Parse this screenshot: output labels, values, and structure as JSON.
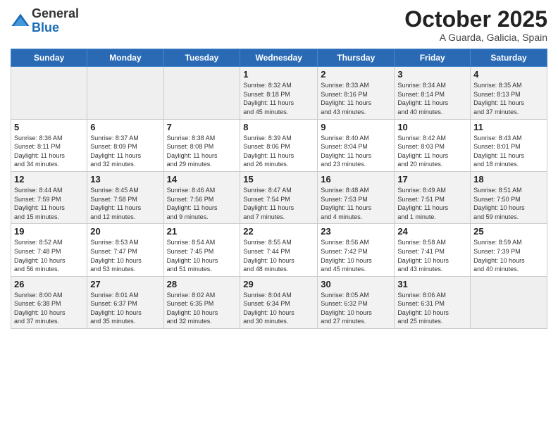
{
  "logo": {
    "general": "General",
    "blue": "Blue"
  },
  "title": {
    "month": "October 2025",
    "location": "A Guarda, Galicia, Spain"
  },
  "weekdays": [
    "Sunday",
    "Monday",
    "Tuesday",
    "Wednesday",
    "Thursday",
    "Friday",
    "Saturday"
  ],
  "rows": [
    [
      {
        "day": "",
        "text": ""
      },
      {
        "day": "",
        "text": ""
      },
      {
        "day": "",
        "text": ""
      },
      {
        "day": "1",
        "text": "Sunrise: 8:32 AM\nSunset: 8:18 PM\nDaylight: 11 hours\nand 45 minutes."
      },
      {
        "day": "2",
        "text": "Sunrise: 8:33 AM\nSunset: 8:16 PM\nDaylight: 11 hours\nand 43 minutes."
      },
      {
        "day": "3",
        "text": "Sunrise: 8:34 AM\nSunset: 8:14 PM\nDaylight: 11 hours\nand 40 minutes."
      },
      {
        "day": "4",
        "text": "Sunrise: 8:35 AM\nSunset: 8:13 PM\nDaylight: 11 hours\nand 37 minutes."
      }
    ],
    [
      {
        "day": "5",
        "text": "Sunrise: 8:36 AM\nSunset: 8:11 PM\nDaylight: 11 hours\nand 34 minutes."
      },
      {
        "day": "6",
        "text": "Sunrise: 8:37 AM\nSunset: 8:09 PM\nDaylight: 11 hours\nand 32 minutes."
      },
      {
        "day": "7",
        "text": "Sunrise: 8:38 AM\nSunset: 8:08 PM\nDaylight: 11 hours\nand 29 minutes."
      },
      {
        "day": "8",
        "text": "Sunrise: 8:39 AM\nSunset: 8:06 PM\nDaylight: 11 hours\nand 26 minutes."
      },
      {
        "day": "9",
        "text": "Sunrise: 8:40 AM\nSunset: 8:04 PM\nDaylight: 11 hours\nand 23 minutes."
      },
      {
        "day": "10",
        "text": "Sunrise: 8:42 AM\nSunset: 8:03 PM\nDaylight: 11 hours\nand 20 minutes."
      },
      {
        "day": "11",
        "text": "Sunrise: 8:43 AM\nSunset: 8:01 PM\nDaylight: 11 hours\nand 18 minutes."
      }
    ],
    [
      {
        "day": "12",
        "text": "Sunrise: 8:44 AM\nSunset: 7:59 PM\nDaylight: 11 hours\nand 15 minutes."
      },
      {
        "day": "13",
        "text": "Sunrise: 8:45 AM\nSunset: 7:58 PM\nDaylight: 11 hours\nand 12 minutes."
      },
      {
        "day": "14",
        "text": "Sunrise: 8:46 AM\nSunset: 7:56 PM\nDaylight: 11 hours\nand 9 minutes."
      },
      {
        "day": "15",
        "text": "Sunrise: 8:47 AM\nSunset: 7:54 PM\nDaylight: 11 hours\nand 7 minutes."
      },
      {
        "day": "16",
        "text": "Sunrise: 8:48 AM\nSunset: 7:53 PM\nDaylight: 11 hours\nand 4 minutes."
      },
      {
        "day": "17",
        "text": "Sunrise: 8:49 AM\nSunset: 7:51 PM\nDaylight: 11 hours\nand 1 minute."
      },
      {
        "day": "18",
        "text": "Sunrise: 8:51 AM\nSunset: 7:50 PM\nDaylight: 10 hours\nand 59 minutes."
      }
    ],
    [
      {
        "day": "19",
        "text": "Sunrise: 8:52 AM\nSunset: 7:48 PM\nDaylight: 10 hours\nand 56 minutes."
      },
      {
        "day": "20",
        "text": "Sunrise: 8:53 AM\nSunset: 7:47 PM\nDaylight: 10 hours\nand 53 minutes."
      },
      {
        "day": "21",
        "text": "Sunrise: 8:54 AM\nSunset: 7:45 PM\nDaylight: 10 hours\nand 51 minutes."
      },
      {
        "day": "22",
        "text": "Sunrise: 8:55 AM\nSunset: 7:44 PM\nDaylight: 10 hours\nand 48 minutes."
      },
      {
        "day": "23",
        "text": "Sunrise: 8:56 AM\nSunset: 7:42 PM\nDaylight: 10 hours\nand 45 minutes."
      },
      {
        "day": "24",
        "text": "Sunrise: 8:58 AM\nSunset: 7:41 PM\nDaylight: 10 hours\nand 43 minutes."
      },
      {
        "day": "25",
        "text": "Sunrise: 8:59 AM\nSunset: 7:39 PM\nDaylight: 10 hours\nand 40 minutes."
      }
    ],
    [
      {
        "day": "26",
        "text": "Sunrise: 8:00 AM\nSunset: 6:38 PM\nDaylight: 10 hours\nand 37 minutes."
      },
      {
        "day": "27",
        "text": "Sunrise: 8:01 AM\nSunset: 6:37 PM\nDaylight: 10 hours\nand 35 minutes."
      },
      {
        "day": "28",
        "text": "Sunrise: 8:02 AM\nSunset: 6:35 PM\nDaylight: 10 hours\nand 32 minutes."
      },
      {
        "day": "29",
        "text": "Sunrise: 8:04 AM\nSunset: 6:34 PM\nDaylight: 10 hours\nand 30 minutes."
      },
      {
        "day": "30",
        "text": "Sunrise: 8:05 AM\nSunset: 6:32 PM\nDaylight: 10 hours\nand 27 minutes."
      },
      {
        "day": "31",
        "text": "Sunrise: 8:06 AM\nSunset: 6:31 PM\nDaylight: 10 hours\nand 25 minutes."
      },
      {
        "day": "",
        "text": ""
      }
    ]
  ]
}
